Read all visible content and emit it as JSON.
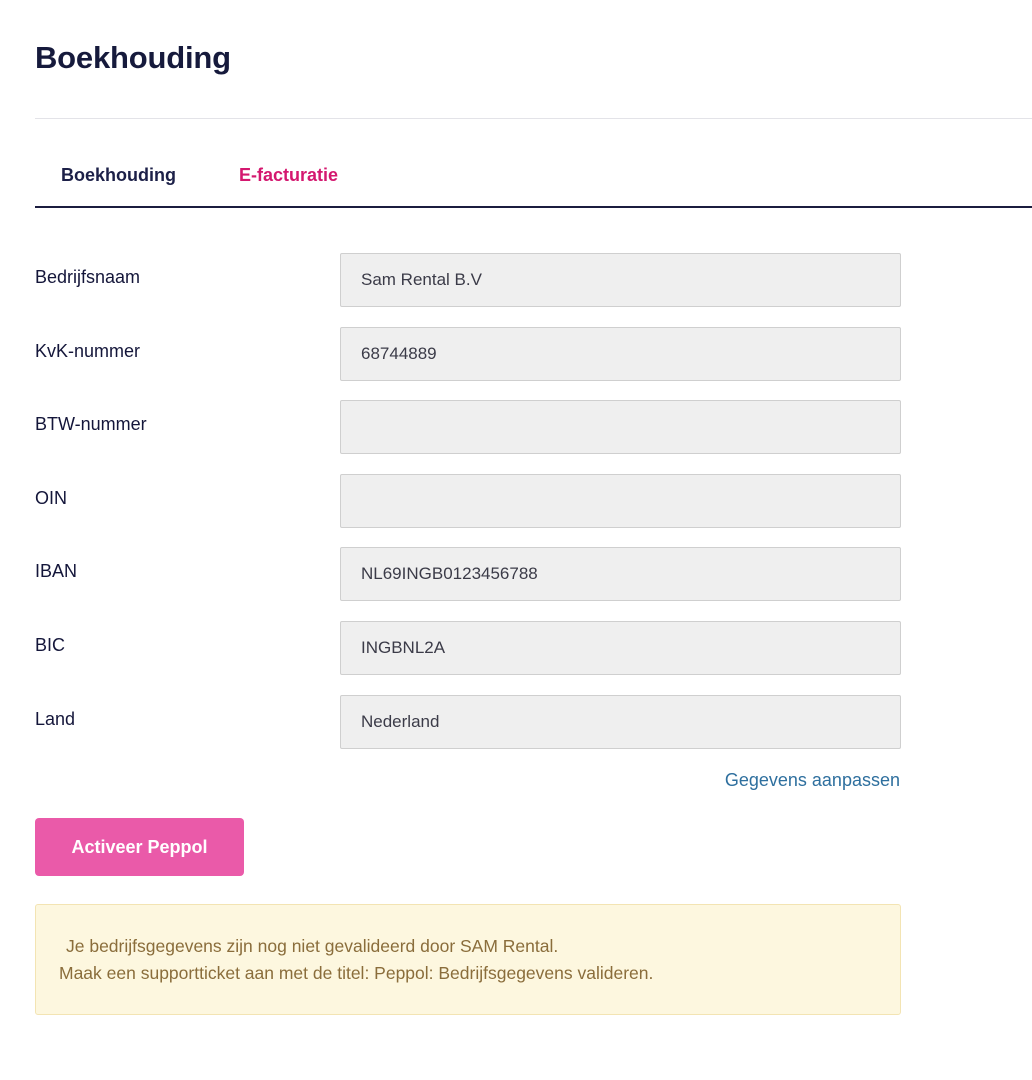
{
  "page": {
    "title": "Boekhouding"
  },
  "tabs": [
    {
      "label": "Boekhouding",
      "active": false
    },
    {
      "label": "E-facturatie",
      "active": true
    }
  ],
  "colors": {
    "active_tab": "#d4186f",
    "primary_button": "#ea5aa9",
    "link": "#2e6f9e",
    "notice_background": "#fdf7df",
    "notice_text": "#8a6d3b"
  },
  "form": {
    "fields": [
      {
        "label": "Bedrijfsnaam",
        "value": "Sam Rental B.V"
      },
      {
        "label": "KvK-nummer",
        "value": "68744889"
      },
      {
        "label": "BTW-nummer",
        "value": ""
      },
      {
        "label": "OIN",
        "value": ""
      },
      {
        "label": "IBAN",
        "value": "NL69INGB0123456788"
      },
      {
        "label": "BIC",
        "value": "INGBNL2A"
      },
      {
        "label": "Land",
        "value": "Nederland"
      }
    ],
    "edit_link": "Gegevens aanpassen"
  },
  "actions": {
    "activate_label": "Activeer Peppol"
  },
  "notice": {
    "line1": "Je bedrijfsgegevens zijn nog niet gevalideerd door SAM Rental.",
    "line2": "Maak een supportticket aan met de titel: Peppol: Bedrijfsgegevens valideren."
  }
}
